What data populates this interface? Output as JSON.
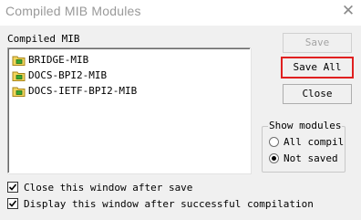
{
  "window": {
    "title": "Compiled MIB Modules",
    "close_glyph": "✕"
  },
  "list": {
    "label": "Compiled MIB",
    "items": [
      {
        "label": "BRIDGE-MIB",
        "icon": "folder-module-icon"
      },
      {
        "label": "DOCS-BPI2-MIB",
        "icon": "folder-module-icon"
      },
      {
        "label": "DOCS-IETF-BPI2-MIB",
        "icon": "folder-module-icon"
      }
    ]
  },
  "buttons": {
    "save": "Save",
    "save_all": "Save All",
    "close": "Close"
  },
  "show_modules": {
    "legend": "Show modules",
    "options": [
      {
        "label": "All compil",
        "selected": false
      },
      {
        "label": "Not saved",
        "selected": true
      }
    ]
  },
  "options": {
    "close_after_save": {
      "label": "Close this window after save",
      "checked": true
    },
    "display_after_compile": {
      "label": "Display this window after successful compilation",
      "checked": true
    }
  },
  "colors": {
    "focus_highlight": "#e02020",
    "folder": "#f2d55c",
    "module_green": "#3aa832"
  }
}
